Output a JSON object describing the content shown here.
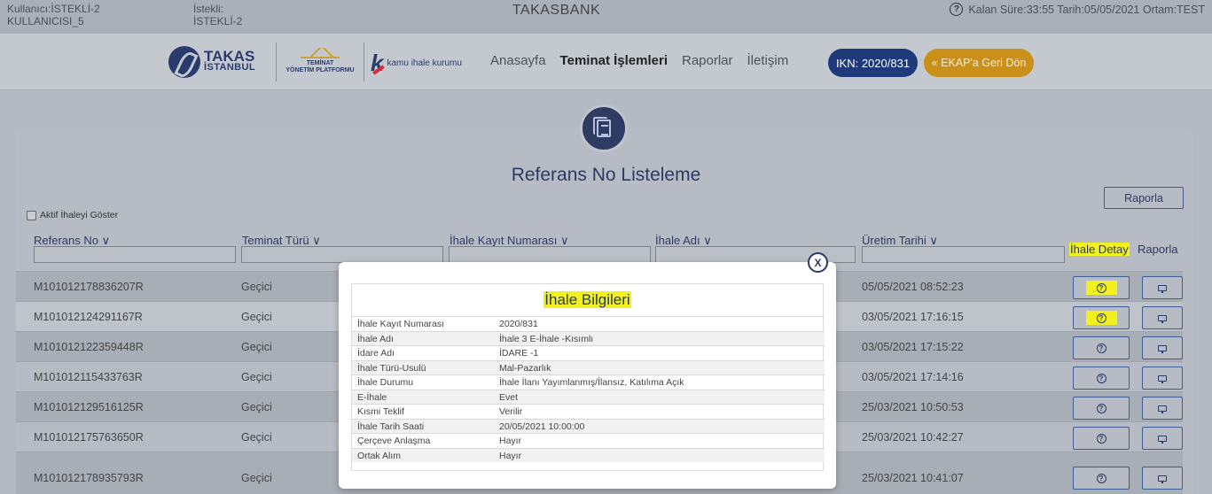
{
  "topbar": {
    "user_line1": "Kullanıcı:İSTEKLİ-2",
    "user_line2": "KULLANICISI_5",
    "bidder_line1": "İstekli:",
    "bidder_line2": "İSTEKLİ-2",
    "title": "TAKASBANK",
    "status": "Kalan Süre:33:55  Tarih:05/05/2021  Ortam:TEST"
  },
  "logos": {
    "takas_line1": "TAKAS",
    "takas_line2": "İSTANBUL",
    "typ_line1": "TEMİNAT",
    "typ_line2": "YÖNETİM PLATFORMU",
    "kik": "kamu ihale kurumu"
  },
  "nav": {
    "items": [
      {
        "label": "Anasayfa",
        "active": false
      },
      {
        "label": "Teminat İşlemleri",
        "active": true
      },
      {
        "label": "Raporlar",
        "active": false
      },
      {
        "label": "İletişim",
        "active": false
      }
    ],
    "ikn_label": "IKN: 2020/831",
    "ekap_label": "« EKAP'a Geri Dön"
  },
  "page": {
    "title": "Referans No Listeleme",
    "raporla_button": "Raporla",
    "aktif_checkbox": "Aktif İhaleyi Göster"
  },
  "table": {
    "columns": [
      "Referans No ∨",
      "Teminat Türü ∨",
      "İhale Kayıt Numarası ∨",
      "İhale Adı ∨",
      "Üretim Tarihi ∨",
      "İhale Detay",
      "Raporla"
    ],
    "rows": [
      {
        "ref": "M101012178836207R",
        "type": "Geçici",
        "date": "05/05/2021 08:52:23"
      },
      {
        "ref": "M101012124291167R",
        "type": "Geçici",
        "date": "03/05/2021 17:16:15"
      },
      {
        "ref": "M101012122359448R",
        "type": "Geçici",
        "date": "03/05/2021 17:15:22"
      },
      {
        "ref": "M101012115433763R",
        "type": "Geçici",
        "date": "03/05/2021 17:14:16"
      },
      {
        "ref": "M101012129516125R",
        "type": "Geçici",
        "date": "25/03/2021 10:50:53"
      },
      {
        "ref": "M101012175763650R",
        "type": "Geçici",
        "date": "25/03/2021 10:42:27"
      },
      {
        "ref": "M101012178935793R",
        "type": "Geçici",
        "date": "25/03/2021 10:41:07"
      }
    ]
  },
  "modal": {
    "close": "X",
    "title": "İhale Bilgileri",
    "rows": [
      {
        "key": "İhale Kayıt Numarası",
        "value": "2020/831"
      },
      {
        "key": "İhale Adı",
        "value": "İhale 3 E-İhale -Kısımlı"
      },
      {
        "key": "İdare Adı",
        "value": "İDARE -1"
      },
      {
        "key": "İhale Türü-Usulü",
        "value": "Mal-Pazarlık"
      },
      {
        "key": "İhale Durumu",
        "value": "İhale İlanı Yayımlanmış/İlansız, Katılıma Açık"
      },
      {
        "key": "E-İhale",
        "value": "Evet"
      },
      {
        "key": "Kısmi Teklif",
        "value": "Verilir"
      },
      {
        "key": "İhale Tarih Saati",
        "value": "20/05/2021 10:00:00"
      },
      {
        "key": "Çerçeve Anlaşma",
        "value": "Hayır"
      },
      {
        "key": "Ortak Alım",
        "value": "Hayır"
      }
    ]
  },
  "colors": {
    "navy": "#2a3a66",
    "ikn_button": "#1f3a7a",
    "ekap_button": "#c9901a",
    "highlight": "#f3f01f"
  }
}
